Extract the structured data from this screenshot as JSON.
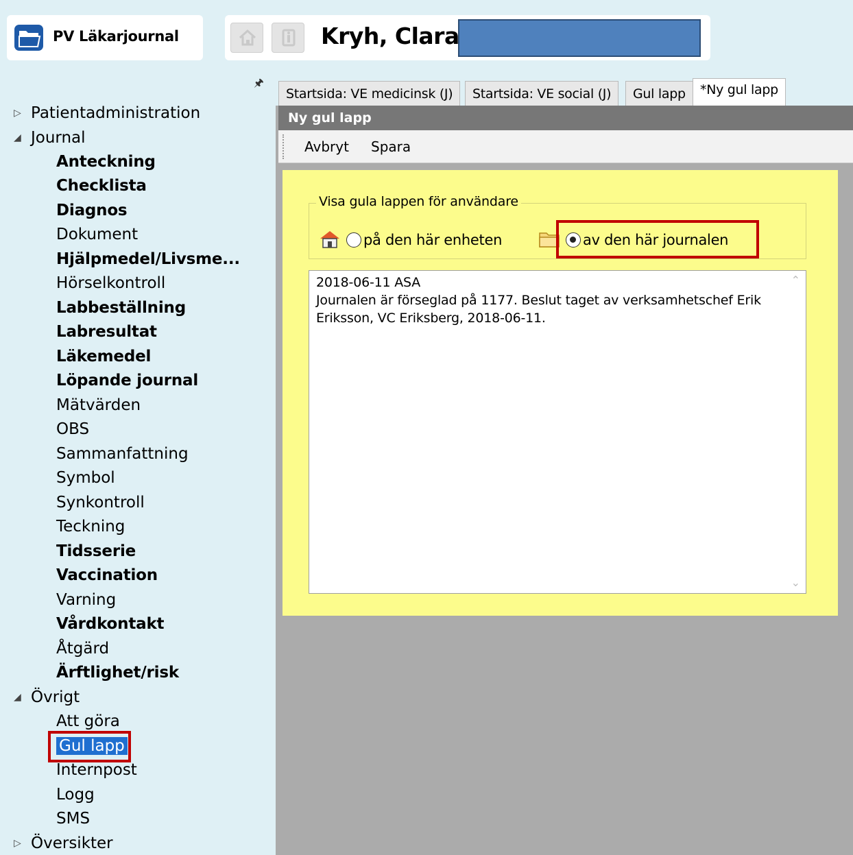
{
  "app": {
    "title": "PV Läkarjournal"
  },
  "patient": {
    "name": "Kryh, Clara"
  },
  "sidebar": {
    "groups": [
      {
        "label": "Patientadministration",
        "expanded": false
      },
      {
        "label": "Journal",
        "expanded": true
      },
      {
        "label": "Övrigt",
        "expanded": true
      },
      {
        "label": "Översikter",
        "expanded": false
      }
    ],
    "journal_items": [
      {
        "label": "Anteckning",
        "bold": true
      },
      {
        "label": "Checklista",
        "bold": true
      },
      {
        "label": "Diagnos",
        "bold": true
      },
      {
        "label": "Dokument",
        "bold": false
      },
      {
        "label": "Hjälpmedel/Livsme...",
        "bold": true
      },
      {
        "label": "Hörselkontroll",
        "bold": false
      },
      {
        "label": "Labbeställning",
        "bold": true
      },
      {
        "label": "Labresultat",
        "bold": true
      },
      {
        "label": "Läkemedel",
        "bold": true
      },
      {
        "label": "Löpande journal",
        "bold": true
      },
      {
        "label": "Mätvärden",
        "bold": false
      },
      {
        "label": "OBS",
        "bold": false
      },
      {
        "label": "Sammanfattning",
        "bold": false
      },
      {
        "label": "Symbol",
        "bold": false
      },
      {
        "label": "Synkontroll",
        "bold": false
      },
      {
        "label": "Teckning",
        "bold": false
      },
      {
        "label": "Tidsserie",
        "bold": true
      },
      {
        "label": "Vaccination",
        "bold": true
      },
      {
        "label": "Varning",
        "bold": false
      },
      {
        "label": "Vårdkontakt",
        "bold": true
      },
      {
        "label": "Åtgärd",
        "bold": false
      },
      {
        "label": "Ärftlighet/risk",
        "bold": true
      }
    ],
    "other_items": [
      {
        "label": "Att göra",
        "selected": false
      },
      {
        "label": "Gul lapp",
        "selected": true
      },
      {
        "label": "Internpost",
        "selected": false
      },
      {
        "label": "Logg",
        "selected": false
      },
      {
        "label": "SMS",
        "selected": false
      }
    ]
  },
  "tabs": [
    {
      "label": "Startsida: VE medicinsk (J)",
      "active": false
    },
    {
      "label": "Startsida: VE social (J)",
      "active": false
    },
    {
      "label": "Gul lapp",
      "active": false
    },
    {
      "label": "*Ny gul lapp",
      "active": true
    }
  ],
  "panel": {
    "title": "Ny gul lapp",
    "toolbar": {
      "cancel": "Avbryt",
      "save": "Spara"
    },
    "visibility": {
      "legend": "Visa gula lappen för användare",
      "option_unit": "på den här enheten",
      "option_journal": "av den här journalen",
      "selected": "journal"
    },
    "note_lines": [
      "2018-06-11  ASA",
      "Journalen är förseglad på 1177. Beslut taget av verksamhetschef Erik",
      "Eriksson, VC Eriksberg, 2018-06-11."
    ]
  },
  "colors": {
    "note_background": "#fcfc8c",
    "highlight_frame": "#c00000",
    "selection": "#1f6fd0"
  }
}
